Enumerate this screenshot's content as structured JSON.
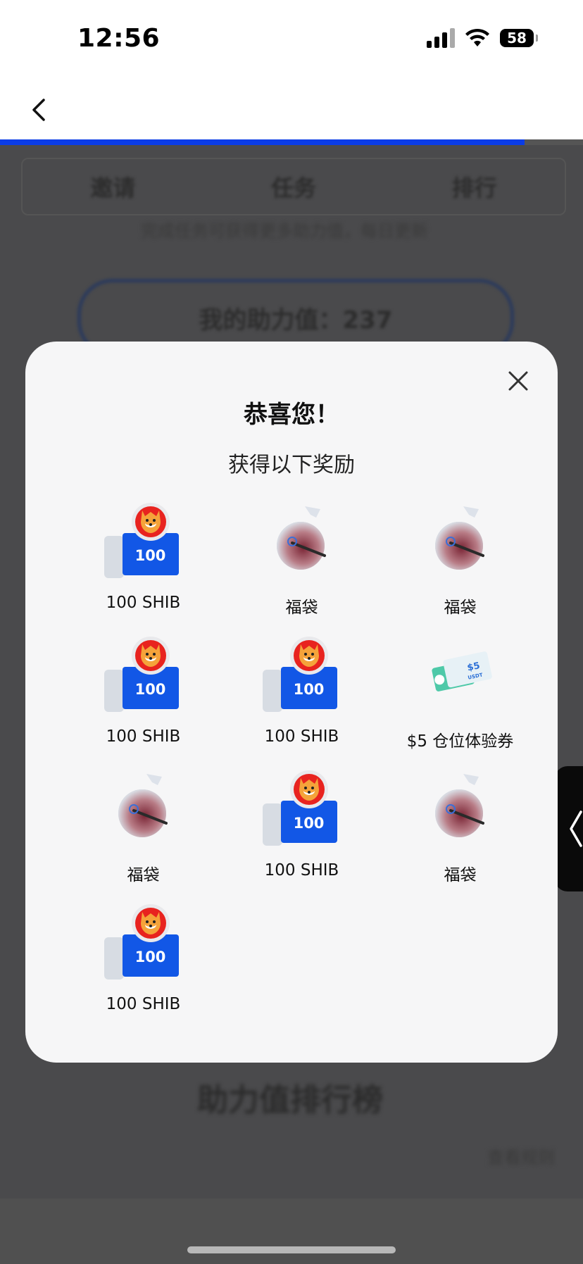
{
  "status_bar": {
    "time": "12:56",
    "battery": "58"
  },
  "progress": {
    "fraction": 0.9
  },
  "background": {
    "tabs": [
      "邀请",
      "任务",
      "排行"
    ],
    "subtitle": "完成任务可获得更多助力值，每日更新",
    "pill_label": "我的助力值：237",
    "section_title": "助力值排行榜",
    "side_link": "查看规则"
  },
  "modal": {
    "title": "恭喜您！",
    "subtitle": "获得以下奖励",
    "rewards": [
      {
        "type": "token",
        "amount": "100",
        "label": "100 SHIB"
      },
      {
        "type": "bag",
        "label": "福袋"
      },
      {
        "type": "bag",
        "label": "福袋"
      },
      {
        "type": "token",
        "amount": "100",
        "label": "100 SHIB"
      },
      {
        "type": "token",
        "amount": "100",
        "label": "100 SHIB"
      },
      {
        "type": "voucher",
        "amount": "$5",
        "unit": "USDT",
        "label": "$5 仓位体验券"
      },
      {
        "type": "bag",
        "label": "福袋"
      },
      {
        "type": "token",
        "amount": "100",
        "label": "100 SHIB"
      },
      {
        "type": "bag",
        "label": "福袋"
      },
      {
        "type": "token",
        "amount": "100",
        "label": "100 SHIB"
      }
    ]
  },
  "icons": {
    "back": "chevron-left-icon",
    "close": "close-icon",
    "side_handle": "chevron-left-icon",
    "token": "shib-token-icon",
    "bag": "lucky-bag-icon",
    "voucher": "usdt-voucher-icon"
  },
  "colors": {
    "accent": "#0a3ce6",
    "coupon": "#1257e6",
    "token": "#e8231f"
  }
}
